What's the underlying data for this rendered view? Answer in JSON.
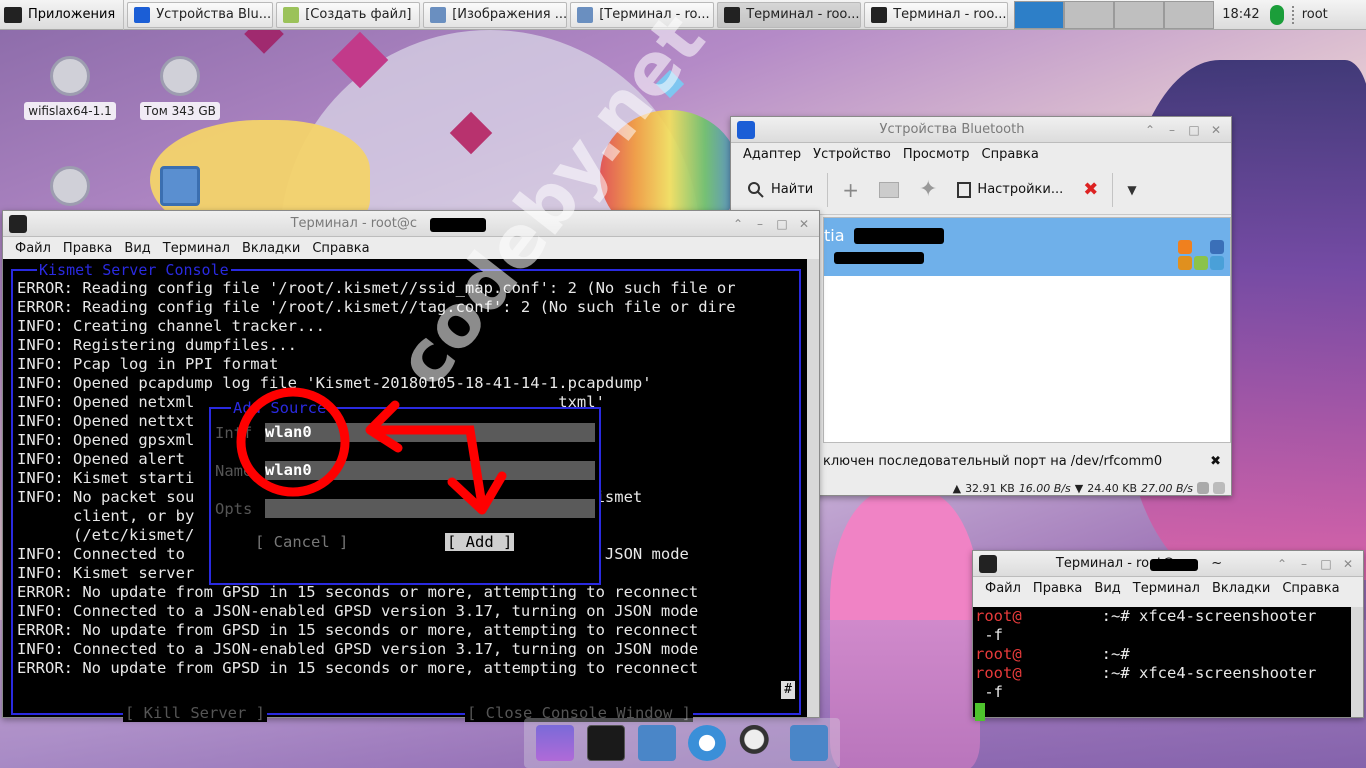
{
  "panel": {
    "apps_label": "Приложения",
    "tasks": [
      {
        "label": "Устройства Blu...",
        "icon": "bluetooth-icon"
      },
      {
        "label": "[Создать файл]",
        "icon": "text-editor-icon"
      },
      {
        "label": "[Изображения ...",
        "icon": "image-viewer-icon"
      },
      {
        "label": "[Терминал - ro...",
        "icon": "terminal-icon"
      },
      {
        "label": "Терминал - roo...",
        "icon": "terminal-icon"
      },
      {
        "label": "Терминал - roo...",
        "icon": "terminal-icon"
      }
    ],
    "clock": "18:42",
    "user": "root"
  },
  "desktop": {
    "icons": [
      {
        "label": "wifislax64-1.1"
      },
      {
        "label": "Том 343 GB"
      }
    ]
  },
  "kismet_window": {
    "title": "Терминал - root@c",
    "title_suffix": "~",
    "menu": [
      "Файл",
      "Правка",
      "Вид",
      "Терминал",
      "Вкладки",
      "Справка"
    ],
    "console_title": "Kismet Server Console",
    "lines": [
      "ERROR: Reading config file '/root/.kismet//ssid_map.conf': 2 (No such file or",
      "ERROR: Reading config file '/root/.kismet//tag.conf': 2 (No such file or dire",
      "INFO: Creating channel tracker...",
      "INFO: Registering dumpfiles...",
      "INFO: Pcap log in PPI format",
      "INFO: Opened pcapdump log file 'Kismet-20180105-18-41-14-1.pcapdump'",
      "INFO: Opened netxml                                       txml'",
      "INFO: Opened nettxt                                       ttxt'",
      "INFO: Opened gpsxml                                       sxml'",
      "INFO: Opened alert                                        rt'",
      "INFO: Kismet starti",
      "INFO: No packet sou                                       he Kismet",
      "      client, or by",
      "      (/etc/kismet/",
      "INFO: Connected to                                        g on JSON mode",
      "INFO: Kismet server",
      "ERROR: No update from GPSD in 15 seconds or more, attempting to reconnect",
      "INFO: Connected to a JSON-enabled GPSD version 3.17, turning on JSON mode",
      "ERROR: No update from GPSD in 15 seconds or more, attempting to reconnect",
      "INFO: Connected to a JSON-enabled GPSD version 3.17, turning on JSON mode",
      "ERROR: No update from GPSD in 15 seconds or more, attempting to reconnect"
    ],
    "kill_server": "[ Kill Server ]",
    "close_console": "[ Close Console Window ]",
    "scroll_marker": "#"
  },
  "add_source_dialog": {
    "title": "Add Source",
    "intf_label": "Intf",
    "intf_value": "wlan0",
    "name_label": "Name",
    "name_value": "wlan0",
    "opts_label": "Opts",
    "opts_value": "",
    "cancel_label": "[ Cancel ]",
    "add_label": "[ Add ]"
  },
  "bluetooth_window": {
    "title": "Устройства Bluetooth",
    "menu": [
      "Адаптер",
      "Устройство",
      "Просмотр",
      "Справка"
    ],
    "toolbar": {
      "search": "Найти",
      "settings": "Настройки..."
    },
    "device_name": "tia",
    "status_text": "ключен последовательный порт на /dev/rfcomm0",
    "upload_total": "32.91 KB",
    "upload_rate": "16.00 B/s",
    "download_total": "24.40 KB",
    "download_rate": "27.00 B/s"
  },
  "small_terminal": {
    "title": "Терминал - root@c",
    "title_suffix": "~",
    "menu": [
      "Файл",
      "Правка",
      "Вид",
      "Терминал",
      "Вкладки",
      "Справка"
    ],
    "lines": [
      {
        "prompt": "root@",
        "tail": ":~# xfce4-screenshooter"
      },
      {
        "prompt": "",
        "tail": " -f"
      },
      {
        "prompt": "root@",
        "tail": ":~#"
      },
      {
        "prompt": "root@",
        "tail": ":~# xfce4-screenshooter"
      },
      {
        "prompt": "",
        "tail": " -f"
      }
    ]
  },
  "watermark": "codeby.net",
  "colors": {
    "kismet_blue": "#2a2ae0",
    "selection_blue": "#6fb0ea",
    "prompt_red": "#e83b3b",
    "cursor_green": "#4ec32d",
    "annotation_red": "#ff0000"
  }
}
